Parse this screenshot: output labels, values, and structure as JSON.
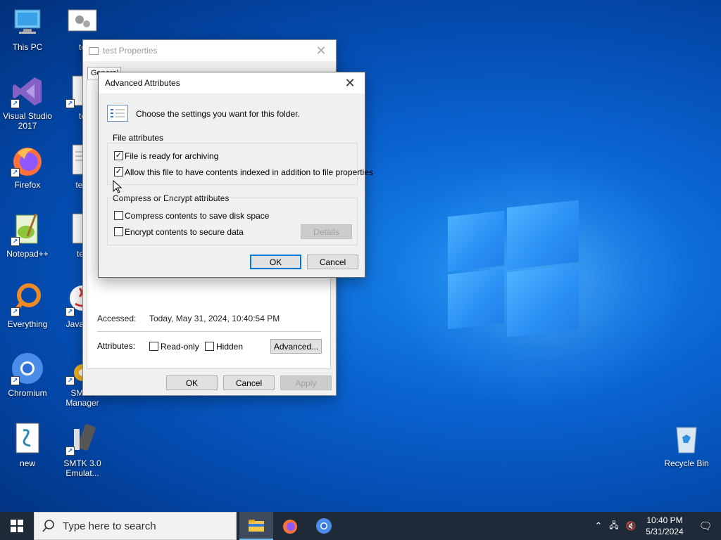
{
  "desktop": {
    "icons": [
      {
        "label": "This PC"
      },
      {
        "label": "Visual Studio 2017"
      },
      {
        "label": "Firefox"
      },
      {
        "label": "Notepad++"
      },
      {
        "label": "Everything"
      },
      {
        "label": "Chromium"
      },
      {
        "label": "new"
      },
      {
        "label": "te"
      },
      {
        "label": "te"
      },
      {
        "label": "test"
      },
      {
        "label": "tes"
      },
      {
        "label": "Java Sta"
      },
      {
        "label": "SMTK Manager"
      },
      {
        "label": "SMTK 3.0 Emulat..."
      },
      {
        "label": "Recycle Bin"
      }
    ]
  },
  "properties": {
    "title": "test Properties",
    "tab_general": "General",
    "accessed_label": "Accessed:",
    "accessed_value": "Today, May 31, 2024, 10:40:54 PM",
    "attributes_label": "Attributes:",
    "readonly_label": "Read-only",
    "hidden_label": "Hidden",
    "advanced_button": "Advanced...",
    "ok": "OK",
    "cancel": "Cancel",
    "apply": "Apply"
  },
  "advanced": {
    "title": "Advanced Attributes",
    "prompt": "Choose the settings you want for this folder.",
    "file_group": "File attributes",
    "archive_label": "File is ready for archiving",
    "archive_checked": true,
    "index_label": "Allow this file to have contents indexed in addition to file properties",
    "index_checked": true,
    "compress_group": "Compress or Encrypt attributes",
    "compress_label": "Compress contents to save disk space",
    "compress_checked": false,
    "encrypt_label": "Encrypt contents to secure data",
    "encrypt_checked": false,
    "details": "Details",
    "ok": "OK",
    "cancel": "Cancel"
  },
  "taskbar": {
    "search_placeholder": "Type here to search",
    "time": "10:40 PM",
    "date": "5/31/2024"
  }
}
